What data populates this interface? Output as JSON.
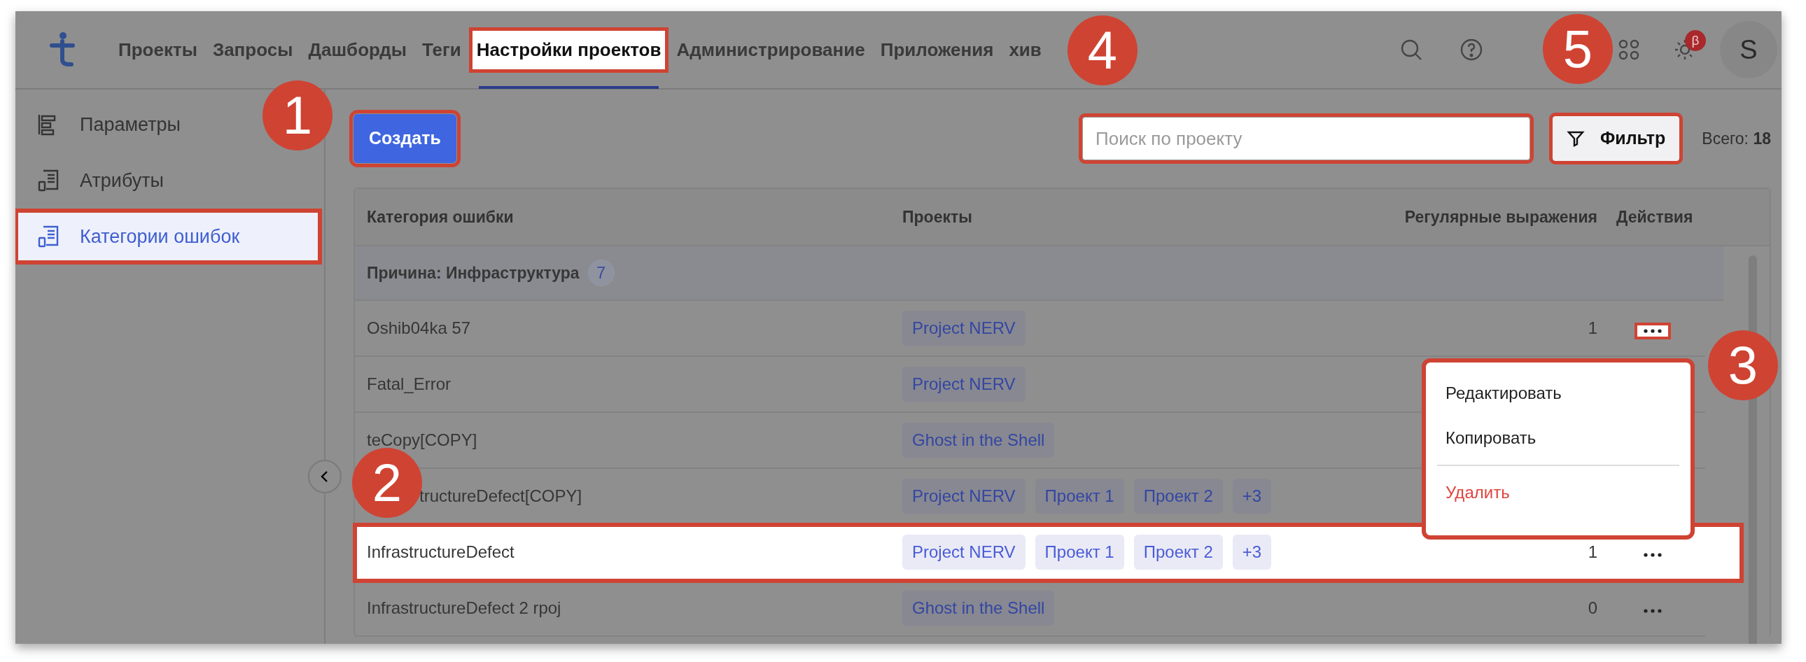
{
  "nav": {
    "items": [
      {
        "label": "Проекты",
        "selected": false,
        "highlighted": false
      },
      {
        "label": "Запросы",
        "selected": false,
        "highlighted": false
      },
      {
        "label": "Дашборды",
        "selected": false,
        "highlighted": false
      },
      {
        "label": "Теги",
        "selected": false,
        "highlighted": false
      },
      {
        "label": "Настройки проектов",
        "selected": true,
        "highlighted": true
      },
      {
        "label": "Администрирование",
        "selected": false,
        "highlighted": false
      },
      {
        "label": "Приложения",
        "selected": false,
        "highlighted": false
      },
      {
        "label": "хив",
        "selected": false,
        "highlighted": false
      }
    ],
    "beta_badge": "β",
    "avatar": "S"
  },
  "sidebar": {
    "items": [
      {
        "label": "Параметры",
        "kind": "params",
        "selected": false,
        "highlighted": false
      },
      {
        "label": "Атрибуты",
        "kind": "list",
        "selected": false,
        "highlighted": false
      },
      {
        "label": "Категории ошибок",
        "kind": "list",
        "selected": true,
        "highlighted": true
      }
    ]
  },
  "toolbar": {
    "create_button": {
      "label": "Создать",
      "highlighted": true
    },
    "search": {
      "placeholder": "Поиск по проекту",
      "highlighted": true
    },
    "filter_button": {
      "label": "Фильтр",
      "highlighted": true
    },
    "total": "Всего: **18**"
  },
  "table": {
    "columns": [
      "Категория ошибки",
      "Проекты",
      "Регулярные выражения",
      "Действия"
    ],
    "group": {
      "label": "Причина: Инфраструктура",
      "count": "7"
    },
    "rows": [
      {
        "name": "Oshib04ka 57",
        "projects": [
          "Project NERV"
        ],
        "regex": "1",
        "actions": {
          "highlighted": true
        },
        "highlighted": false
      },
      {
        "name": "Fatal_Error",
        "projects": [
          "Project NERV"
        ],
        "highlighted": false
      },
      {
        "name": "teCopy[COPY]",
        "projects": [
          "Ghost in the Shell"
        ],
        "highlighted": false
      },
      {
        "name": "tructureDefect[COPY]",
        "projects": [
          "Project NERV",
          "Проект 1",
          "Проект 2",
          "+3"
        ],
        "highlighted": false
      },
      {
        "name": "InfrastructureDefect",
        "projects": [
          "Project NERV",
          "Проект 1",
          "Проект 2",
          "+3"
        ],
        "regex": "1",
        "actions": {
          "highlighted": false
        },
        "highlighted": true
      },
      {
        "name": "InfrastructureDefect 2 rpoj",
        "projects": [
          "Ghost in the Shell"
        ],
        "regex": "0",
        "actions": {
          "highlighted": false
        },
        "highlighted": false
      }
    ]
  },
  "menu": {
    "highlighted": true,
    "items": [
      {
        "label": "Редактировать",
        "danger": false
      },
      {
        "label": "Копировать",
        "danger": false
      },
      {
        "label": "Удалить",
        "danger": true
      }
    ]
  },
  "callouts": [
    "1",
    "2",
    "3",
    "4",
    "5"
  ]
}
